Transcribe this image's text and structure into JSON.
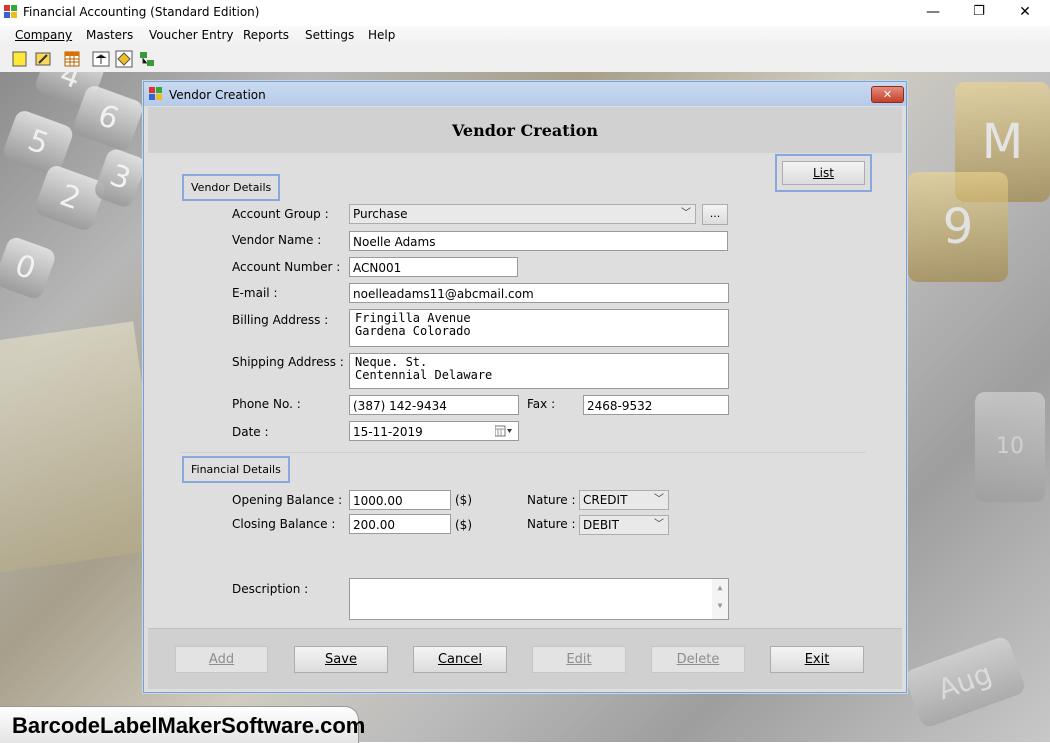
{
  "window": {
    "title": "Financial Accounting (Standard Edition)",
    "minimize": "—",
    "maximize": "❐",
    "close": "✕"
  },
  "menu": [
    "Company",
    "Masters",
    "Voucher Entry",
    "Reports",
    "Settings",
    "Help"
  ],
  "toolbar_icons": [
    "new-icon",
    "open-icon",
    "calendar-icon",
    "balance-icon",
    "diamond-icon",
    "group-icon"
  ],
  "dialog": {
    "title": "Vendor Creation",
    "heading": "Vendor Creation",
    "close": "✕",
    "list_button": "List",
    "vendor_details_group": "Vendor Details",
    "financial_details_group": "Financial Details",
    "labels": {
      "account_group": "Account Group :",
      "vendor_name": "Vendor Name :",
      "account_number": "Account Number :",
      "email": "E-mail :",
      "billing_address": "Billing Address :",
      "shipping_address": "Shipping Address :",
      "phone": "Phone No. :",
      "fax": "Fax :",
      "date": "Date :",
      "opening_balance": "Opening Balance :",
      "closing_balance": "Closing Balance :",
      "nature": "Nature :",
      "currency": "($)",
      "description": "Description :"
    },
    "values": {
      "account_group": "Purchase",
      "browse": "...",
      "vendor_name": "Noelle Adams",
      "account_number": "ACN001",
      "email": "noelleadams11@abcmail.com",
      "billing_line1": "Fringilla Avenue",
      "billing_line2": "Gardena Colorado",
      "shipping_line1": "Neque. St.",
      "shipping_line2": "Centennial Delaware",
      "phone": "(387) 142-9434",
      "fax": "2468-9532",
      "date": "15-11-2019",
      "opening_balance": "1000.00",
      "opening_nature": "CREDIT",
      "closing_balance": "200.00",
      "closing_nature": "DEBIT",
      "description": ""
    },
    "buttons": {
      "add": "Add",
      "save": "Save",
      "cancel": "Cancel",
      "edit": "Edit",
      "delete": "Delete",
      "exit": "Exit"
    }
  },
  "background_keys": [
    "4",
    "5",
    "6",
    "2",
    "3",
    "0",
    "9",
    "M",
    "10",
    "Aug"
  ],
  "watermark": "BarcodeLabelMakerSoftware.com"
}
